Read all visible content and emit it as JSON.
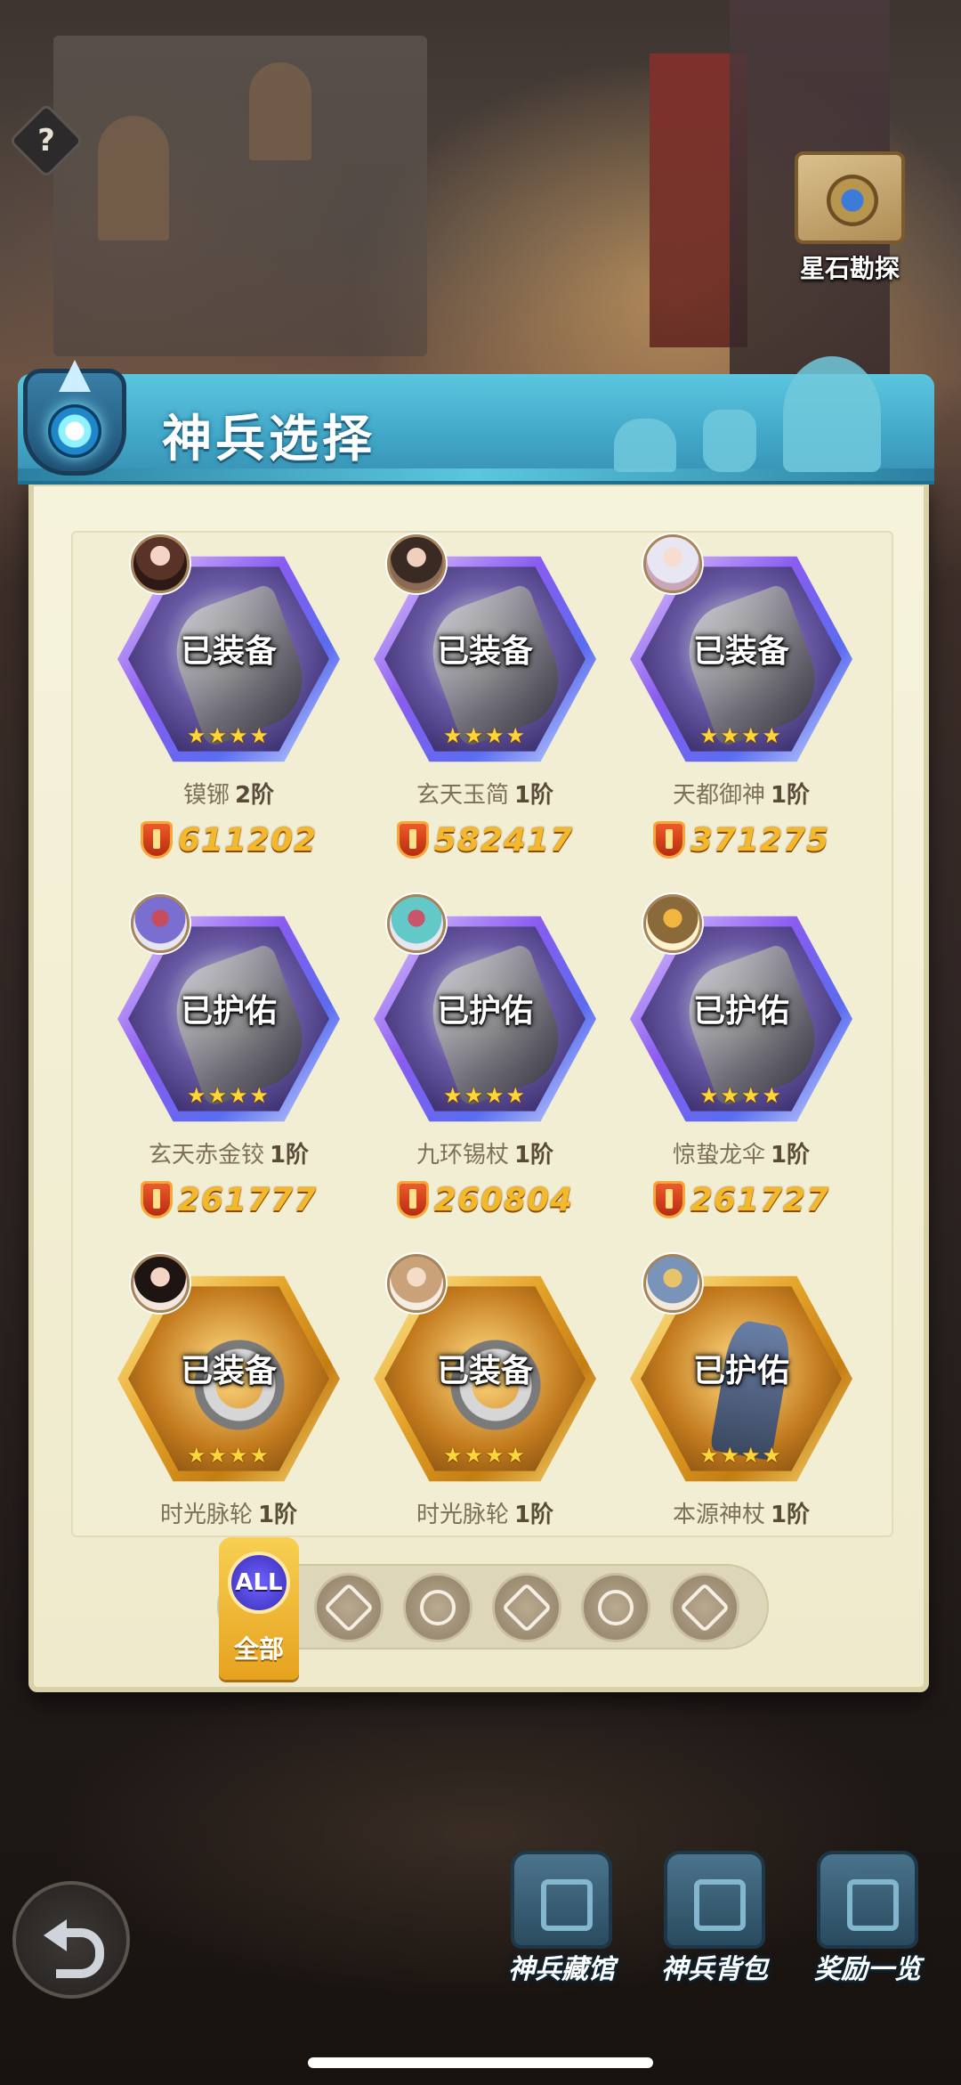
{
  "hud": {
    "help_label": "?",
    "star_explore_label": "星石勘探"
  },
  "panel": {
    "title": "神兵选择"
  },
  "weapons": [
    {
      "status": "已装备",
      "stars": "★★★★",
      "name": "镆铘",
      "tier": "2阶",
      "power": "611202",
      "frame": "purple"
    },
    {
      "status": "已装备",
      "stars": "★★★★",
      "name": "玄天玉简",
      "tier": "1阶",
      "power": "582417",
      "frame": "purple"
    },
    {
      "status": "已装备",
      "stars": "★★★★",
      "name": "天都御神",
      "tier": "1阶",
      "power": "371275",
      "frame": "purple"
    },
    {
      "status": "已护佑",
      "stars": "★★★★",
      "name": "玄天赤金铰",
      "tier": "1阶",
      "power": "261777",
      "frame": "purple"
    },
    {
      "status": "已护佑",
      "stars": "★★★★",
      "name": "九环锡杖",
      "tier": "1阶",
      "power": "260804",
      "frame": "purple"
    },
    {
      "status": "已护佑",
      "stars": "★★★★",
      "name": "惊蛰龙伞",
      "tier": "1阶",
      "power": "261727",
      "frame": "purple"
    },
    {
      "status": "已装备",
      "stars": "★★★★",
      "name": "时光脉轮",
      "tier": "1阶",
      "power": "",
      "frame": "gold"
    },
    {
      "status": "已装备",
      "stars": "★★★★",
      "name": "时光脉轮",
      "tier": "1阶",
      "power": "",
      "frame": "gold"
    },
    {
      "status": "已护佑",
      "stars": "★★★★",
      "name": "本源神杖",
      "tier": "1阶",
      "power": "",
      "frame": "gold"
    }
  ],
  "filter": {
    "all_badge": "ALL",
    "all_label": "全部",
    "icons": [
      "class-icon-1",
      "class-icon-2",
      "class-icon-3",
      "class-icon-4",
      "class-icon-5"
    ]
  },
  "bottom_nav": {
    "armory_label": "神兵藏馆",
    "backpack_label": "神兵背包",
    "rewards_label": "奖励一览"
  },
  "colors": {
    "title_bar": "#43a9c9",
    "panel_bg": "#f6f3dc",
    "power_text": "#f3b92a",
    "filter_active": "#f8cf52"
  }
}
